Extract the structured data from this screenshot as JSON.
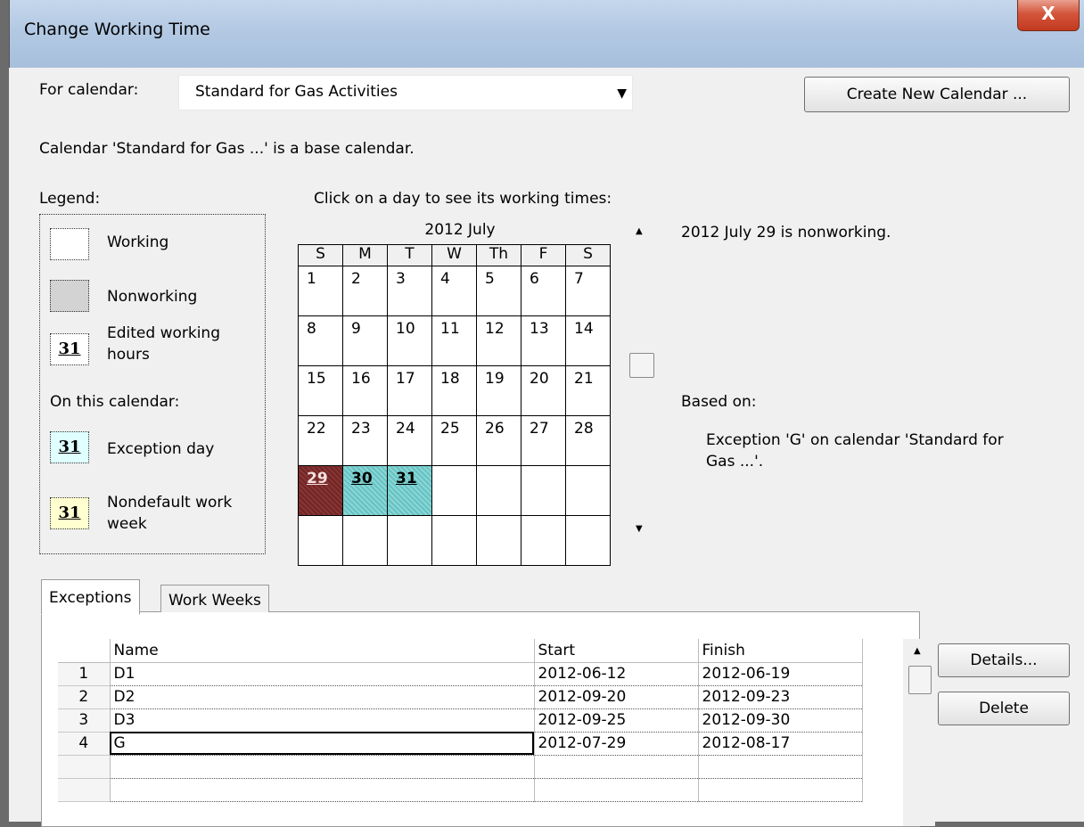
{
  "window": {
    "title": "Change Working Time",
    "close_label": "X"
  },
  "for_calendar": {
    "label": "For calendar:",
    "value": "Standard for Gas Activities",
    "arrow": "▼"
  },
  "create_button": "Create New Calendar ...",
  "base_note": "Calendar 'Standard for Gas ...' is a base calendar.",
  "legend": {
    "title": "Legend:",
    "working": "Working",
    "nonworking": "Nonworking",
    "edited_line1": "Edited working",
    "edited_line2": "hours",
    "on_this": "On this calendar:",
    "exception": "Exception day",
    "nondefault_line1": "Nondefault work",
    "nondefault_line2": "week",
    "sample_day": "31",
    "colors": {
      "nonworking": "#d3d3d3",
      "exception": "#e0ffff",
      "nondefault": "#ffffd0",
      "exception_cell": "#66c2c2",
      "selected": "#8a3434"
    }
  },
  "calendar": {
    "prompt": "Click on a day to see its working times:",
    "month_title": "2012 July",
    "days": [
      "S",
      "M",
      "T",
      "W",
      "Th",
      "F",
      "S"
    ],
    "weeks": [
      [
        "1",
        "2",
        "3",
        "4",
        "5",
        "6",
        "7"
      ],
      [
        "8",
        "9",
        "10",
        "11",
        "12",
        "13",
        "14"
      ],
      [
        "15",
        "16",
        "17",
        "18",
        "19",
        "20",
        "21"
      ],
      [
        "22",
        "23",
        "24",
        "25",
        "26",
        "27",
        "28"
      ],
      [
        "29",
        "30",
        "31",
        "",
        "",
        "",
        ""
      ],
      [
        "",
        "",
        "",
        "",
        "",
        "",
        ""
      ]
    ],
    "scroll_up": "▲",
    "scroll_down": "▼"
  },
  "info": {
    "status": "2012 July 29 is nonworking.",
    "based_on_label": "Based on:",
    "based_on_line1": "Exception 'G' on calendar 'Standard for",
    "based_on_line2": "Gas ...'."
  },
  "tabs": [
    {
      "label": "Exceptions"
    },
    {
      "label": "Work Weeks"
    }
  ],
  "exceptions": {
    "headers": {
      "num": "",
      "name": "Name",
      "start": "Start",
      "finish": "Finish"
    },
    "rows": [
      {
        "num": "1",
        "name": "D1",
        "start": "2012-06-12",
        "finish": "2012-06-19"
      },
      {
        "num": "2",
        "name": "D2",
        "start": "2012-09-20",
        "finish": "2012-09-23"
      },
      {
        "num": "3",
        "name": "D3",
        "start": "2012-09-25",
        "finish": "2012-09-30"
      },
      {
        "num": "4",
        "name": "G",
        "start": "2012-07-29",
        "finish": "2012-08-17"
      },
      {
        "num": "",
        "name": "",
        "start": "",
        "finish": ""
      },
      {
        "num": "",
        "name": "",
        "start": "",
        "finish": ""
      }
    ],
    "scroll_up": "▲"
  },
  "buttons": {
    "details": "Details...",
    "delete": "Delete"
  }
}
